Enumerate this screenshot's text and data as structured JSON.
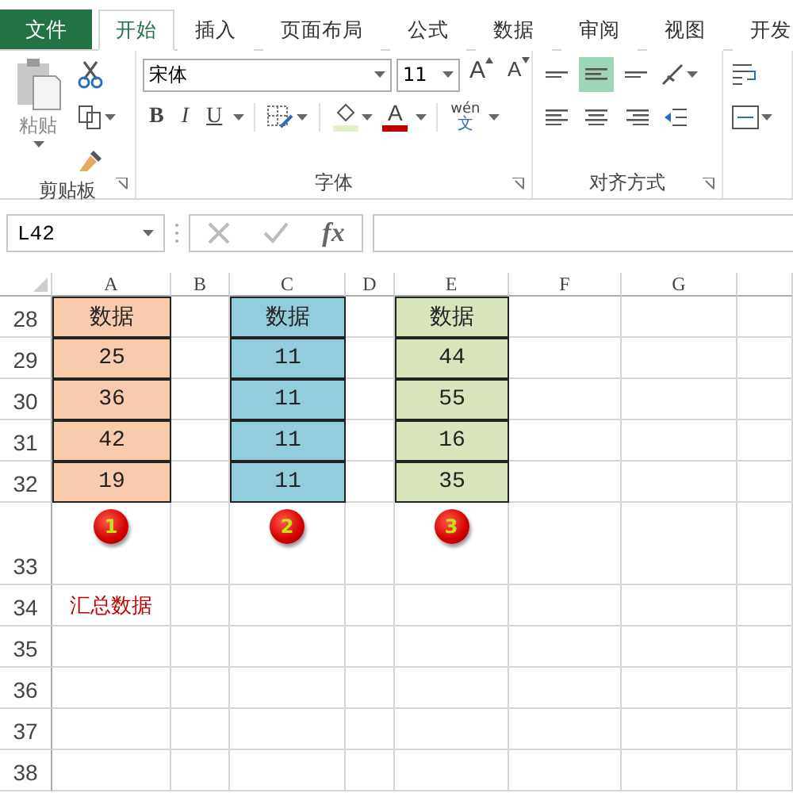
{
  "file_tab": "文件",
  "tabs": [
    {
      "label": "开始",
      "selected": true
    },
    {
      "label": "插入",
      "selected": false
    },
    {
      "label": "页面布局",
      "selected": false
    },
    {
      "label": "公式",
      "selected": false
    },
    {
      "label": "数据",
      "selected": false
    },
    {
      "label": "审阅",
      "selected": false
    },
    {
      "label": "视图",
      "selected": false
    },
    {
      "label": "开发",
      "selected": false
    }
  ],
  "ribbon": {
    "clipboard": {
      "label": "剪贴板",
      "paste_label": "粘贴"
    },
    "font": {
      "label": "字体",
      "font_name": "宋体",
      "font_size": "11",
      "grow_label": "A",
      "shrink_label": "A",
      "format_buttons": [
        "B",
        "I",
        "U"
      ],
      "font_color_label": "A",
      "phonetic_top": "wén",
      "phonetic_bottom": "文"
    },
    "alignment": {
      "label": "对齐方式"
    }
  },
  "formula_bar": {
    "name_box": "L42",
    "fx_label": "fx"
  },
  "columns": [
    {
      "letter": "A",
      "color": "#f8cbad"
    },
    {
      "letter": "B"
    },
    {
      "letter": "C",
      "color": "#92cddc"
    },
    {
      "letter": "D"
    },
    {
      "letter": "E",
      "color": "#d8e4bc"
    },
    {
      "letter": "F"
    },
    {
      "letter": "G"
    }
  ],
  "rows": [
    {
      "number": "28",
      "cells": {
        "A": {
          "kind": "data",
          "text": "数据"
        },
        "C": {
          "kind": "data",
          "text": "数据"
        },
        "E": {
          "kind": "data",
          "text": "数据"
        }
      }
    },
    {
      "number": "29",
      "cells": {
        "A": {
          "kind": "data",
          "text": "25"
        },
        "C": {
          "kind": "data",
          "text": "11"
        },
        "E": {
          "kind": "data",
          "text": "44"
        }
      }
    },
    {
      "number": "30",
      "cells": {
        "A": {
          "kind": "data",
          "text": "36"
        },
        "C": {
          "kind": "data",
          "text": "11"
        },
        "E": {
          "kind": "data",
          "text": "55"
        }
      }
    },
    {
      "number": "31",
      "cells": {
        "A": {
          "kind": "data",
          "text": "42"
        },
        "C": {
          "kind": "data",
          "text": "11"
        },
        "E": {
          "kind": "data",
          "text": "16"
        }
      }
    },
    {
      "number": "32",
      "cells": {
        "A": {
          "kind": "data",
          "text": "19"
        },
        "C": {
          "kind": "data",
          "text": "11"
        },
        "E": {
          "kind": "data",
          "text": "35"
        }
      }
    },
    {
      "number": "33",
      "cells": {
        "A": {
          "kind": "badge",
          "text": "1"
        },
        "C": {
          "kind": "badge",
          "text": "2"
        },
        "E": {
          "kind": "badge",
          "text": "3"
        }
      }
    },
    {
      "number": "34",
      "cells": {
        "A": {
          "kind": "note",
          "text": "汇总数据"
        }
      }
    },
    {
      "number": "35"
    },
    {
      "number": "36"
    },
    {
      "number": "37"
    },
    {
      "number": "38"
    }
  ]
}
